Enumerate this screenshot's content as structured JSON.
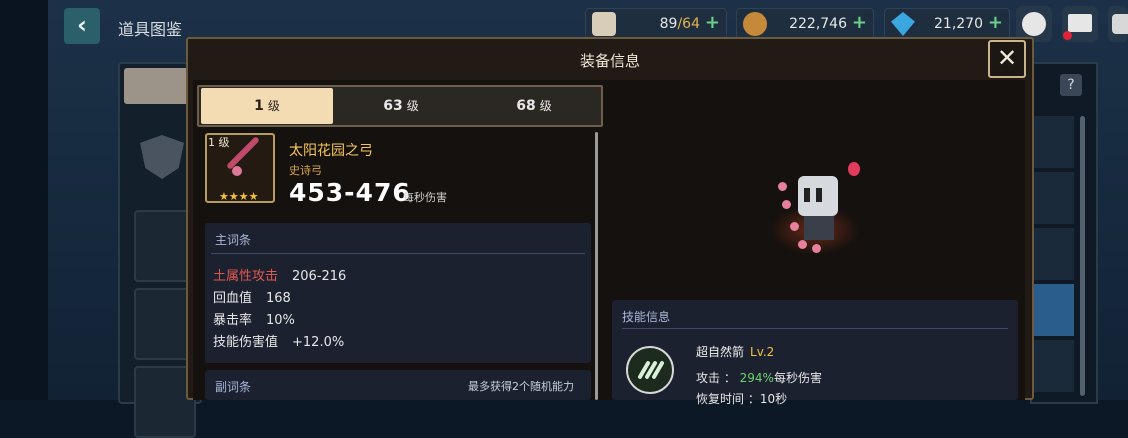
{
  "header": {
    "back_icon": "chevron-left-icon",
    "title": "道具图鉴"
  },
  "resources": [
    {
      "icon": "coffee-cup-icon",
      "value_main": "89",
      "value_sep": "/",
      "value_max": "64",
      "color": "#e6b24c"
    },
    {
      "icon": "gold-coin-icon",
      "value": "222,746"
    },
    {
      "icon": "gem-icon",
      "value": "21,270"
    }
  ],
  "top_icons": [
    "chat-icon",
    "mail-icon",
    "settings-icon"
  ],
  "modal": {
    "title": "装备信息",
    "close_icon": "close-icon",
    "level_tabs": [
      {
        "value": "1",
        "unit": "级",
        "active": true
      },
      {
        "value": "63",
        "unit": "级",
        "active": false
      },
      {
        "value": "68",
        "unit": "级",
        "active": false
      }
    ],
    "item": {
      "level": "1",
      "level_unit": "级",
      "stars": "★★★★",
      "name": "太阳花园之弓",
      "type": "史诗弓",
      "damage": "453-476",
      "damage_unit": "每秒伤害"
    },
    "main_stats": {
      "title": "主词条",
      "rows": [
        {
          "label": "土属性攻击",
          "value": "206-216",
          "highlight": true
        },
        {
          "label": "回血值",
          "value": "168"
        },
        {
          "label": "暴击率",
          "value": "10%"
        },
        {
          "label": "技能伤害值",
          "value": "+12.0%"
        }
      ]
    },
    "sub_stats": {
      "title": "副词条",
      "note": "最多获得2个随机能力"
    },
    "skill": {
      "header": "技能信息",
      "icon": "claw-slash-icon",
      "name": "超自然箭",
      "level": "Lv.2",
      "attack_label": "攻击 ：",
      "attack_value": "294%",
      "attack_unit": "每秒伤害",
      "cooldown": "恢复时间 ：10秒"
    }
  },
  "gallery_help": "?"
}
